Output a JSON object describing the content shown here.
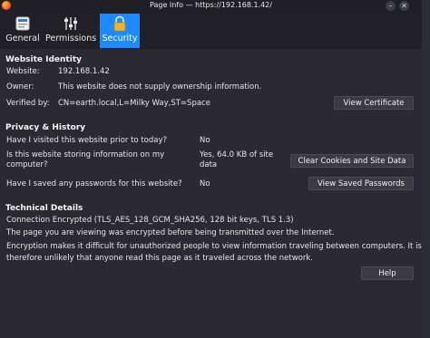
{
  "window": {
    "title": "Page Info — https://192.168.1.42/",
    "minimize": "–",
    "close": "✕"
  },
  "tabs": [
    {
      "label": "General"
    },
    {
      "label": "Permissions"
    },
    {
      "label": "Security"
    }
  ],
  "identity": {
    "heading": "Website Identity",
    "website_label": "Website:",
    "website_value": "192.168.1.42",
    "owner_label": "Owner:",
    "owner_value": "This website does not supply ownership information.",
    "verified_label": "Verified by:",
    "verified_value": "CN=earth.local,L=Milky Way,ST=Space",
    "view_certificate": "View Certificate"
  },
  "privacy": {
    "heading": "Privacy & History",
    "q1": "Have I visited this website prior to today?",
    "a1": "No",
    "q2_line1": "Is this website storing information on my",
    "q2_line2": "computer?",
    "a2_line1": "Yes, 64.0 KB of site",
    "a2_line2": "data",
    "clear_button": "Clear Cookies and Site Data",
    "q3": "Have I saved any passwords for this website?",
    "a3": "No",
    "passwords_button": "View Saved Passwords"
  },
  "technical": {
    "heading": "Technical Details",
    "line1": "Connection Encrypted (TLS_AES_128_GCM_SHA256, 128 bit keys, TLS 1.3)",
    "line2": "The page you are viewing was encrypted before being transmitted over the Internet.",
    "line3": "Encryption makes it difficult for unauthorized people to view information traveling between computers. It is",
    "line4": "therefore unlikely that anyone read this page as it traveled across the network."
  },
  "help_button": "Help"
}
